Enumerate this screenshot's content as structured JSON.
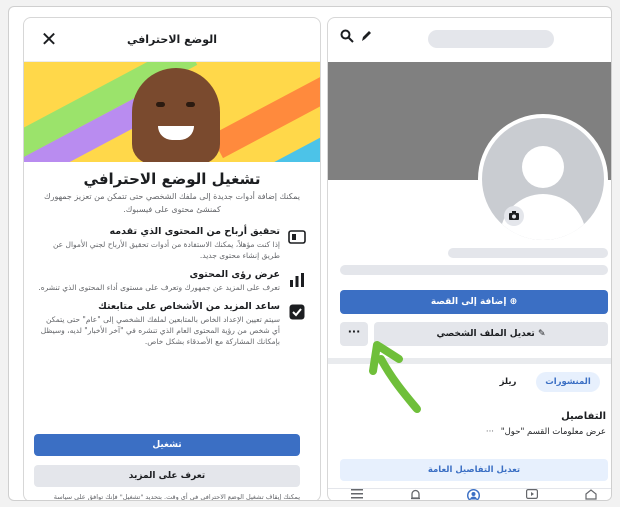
{
  "sheet": {
    "title": "الوضع الاحترافي",
    "close_glyph": "✕",
    "heading": "تشغيل الوضع الاحترافي",
    "subtitle": "يمكنك إضافة أدوات جديدة إلى ملفك الشخصي حتى تتمكن من تعزيز جمهورك كمنشئ محتوى على فيسبوك.",
    "features": [
      {
        "icon": "dollar-icon",
        "title": "تحقيق أرباح من المحتوى الذي تقدمه",
        "desc": "إذا كنت مؤهلاً، يمكنك الاستفادة من أدوات تحقيق الأرباح لجني الأموال عن طريق إنشاء محتوى جديد."
      },
      {
        "icon": "chart-icon",
        "title": "عرض رؤى المحتوى",
        "desc": "تعرف على المزيد عن جمهورك وتعرف على مستوى أداء المحتوى الذي تنشره."
      },
      {
        "icon": "checkbox-icon",
        "title": "ساعد المزيد من الأشخاص على متابعتك",
        "desc": "سيتم تعيين الإعداد الخاص بالمتابعين لملفك الشخصي إلى \"عام\" حتى يتمكن أي شخص من رؤية المحتوى العام الذي تنشره في \"آخر الأخبار\" لديه، وسيظل بإمكانك المشاركة مع الأصدقاء بشكل خاص."
      }
    ],
    "primary_button": "تشغيل",
    "secondary_button": "تعرف على المزيد",
    "footnote": "يمكنك إيقاف تشغيل الوضع الاحترافي في أي وقت. بتحديد \"تشغيل\" فإنك توافق على سياسة الوضع الاحترافي."
  },
  "profile": {
    "add_story": "⊕ إضافة إلى القصة",
    "edit_profile": "✎ تعديل الملف الشخصي",
    "more": "···",
    "tabs": {
      "posts": "المنشورات",
      "reels": "ريلز"
    },
    "details_title": "التفاصيل",
    "details_item": "عرض معلومات القسم \"حول\"",
    "details_dots": "···",
    "edit_public_details": "تعديل التفاصيل العامة"
  },
  "colors": {
    "accent": "#3b6fc4",
    "arrow": "#6fbf3a",
    "cover": "#808080"
  }
}
